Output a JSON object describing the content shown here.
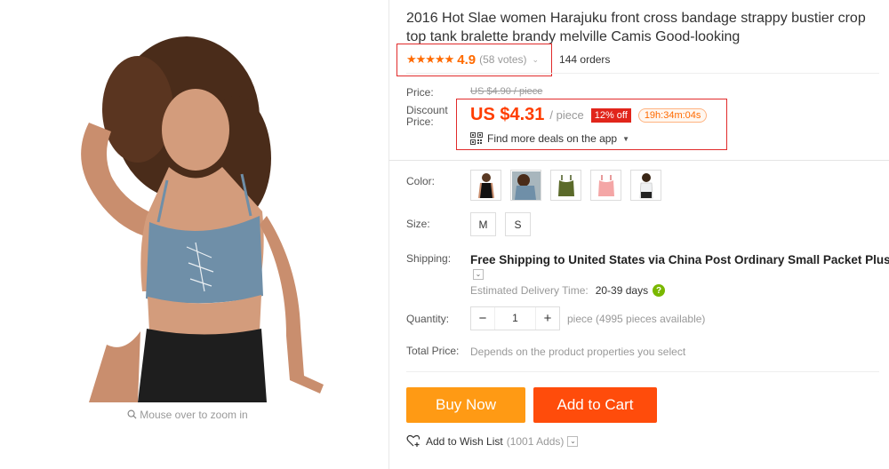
{
  "gallery": {
    "zoom_hint": "Mouse over to zoom in"
  },
  "product": {
    "title": "2016 Hot Slae women Harajuku front cross bandage strappy bustier crop top tank bralette brandy melville Camis Good-looking",
    "stars": "★★★★★",
    "rating": "4.9",
    "votes": "(58 votes)",
    "orders": "144 orders"
  },
  "price": {
    "label": "Price:",
    "original": "US $4.90 / piece",
    "discount_label": "Discount Price:",
    "current": "US $4.31",
    "unit": "/ piece",
    "discount": "12% off",
    "timer": "19h:34m:04s",
    "app_deals": "Find more deals on the app"
  },
  "options": {
    "color_label": "Color:",
    "colors": [
      "black",
      "grey",
      "olive",
      "pink",
      "white"
    ],
    "size_label": "Size:",
    "sizes": [
      "M",
      "S"
    ]
  },
  "shipping": {
    "label": "Shipping:",
    "free": "Free Shipping to",
    "rest": "United States via China Post Ordinary Small Packet Plus",
    "eta_label": "Estimated Delivery Time:",
    "eta_value": "20-39 days"
  },
  "quantity": {
    "label": "Quantity:",
    "value": "1",
    "note": "piece (4995 pieces available)"
  },
  "total": {
    "label": "Total Price:",
    "value": "Depends on the product properties you select"
  },
  "actions": {
    "buy_now": "Buy Now",
    "add_to_cart": "Add to Cart",
    "wishlist": "Add to Wish List",
    "wishlist_count": "(1001 Adds)"
  },
  "colors": {
    "accent": "#ff6a00",
    "price": "#ff3e00",
    "buy_now": "#ff9a14",
    "add_to_cart": "#ff4c0b",
    "highlight_box": "#e12b2b"
  }
}
